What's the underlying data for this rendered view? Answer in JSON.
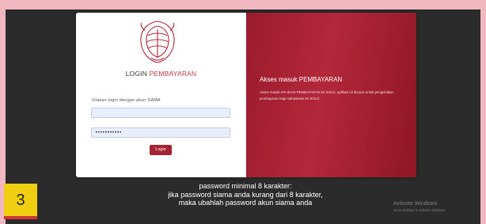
{
  "login": {
    "brand_part1": "LOGIN",
    "brand_part2": "PEMBAYARAN",
    "prompt": "Silakan login dengan akun SIAMA",
    "username_value": "",
    "password_masked": "•••••••••••",
    "login_button": "Login"
  },
  "info": {
    "title": "Akses masuk PEMBAYARAN",
    "description": "Akses masuk APLIKASI PEMBAYARAN ISI SOLO, aplikasi ini khusus untuk pengelolaan pembayaran bagi mahasiswa ISI SOLO."
  },
  "step": {
    "number": "3"
  },
  "caption": {
    "line1": "password minimal 8 karakter:",
    "line2": "jika password siama anda kurang dari 8 karakter,",
    "line3": "maka ubahlah password akun siama anda"
  },
  "watermark": {
    "line1": "Activate Windows",
    "line2": "Go to Settings to activate Windows."
  },
  "colors": {
    "accent": "#a32332",
    "frame": "#f2b8c2",
    "badge": "#f0cf12"
  }
}
